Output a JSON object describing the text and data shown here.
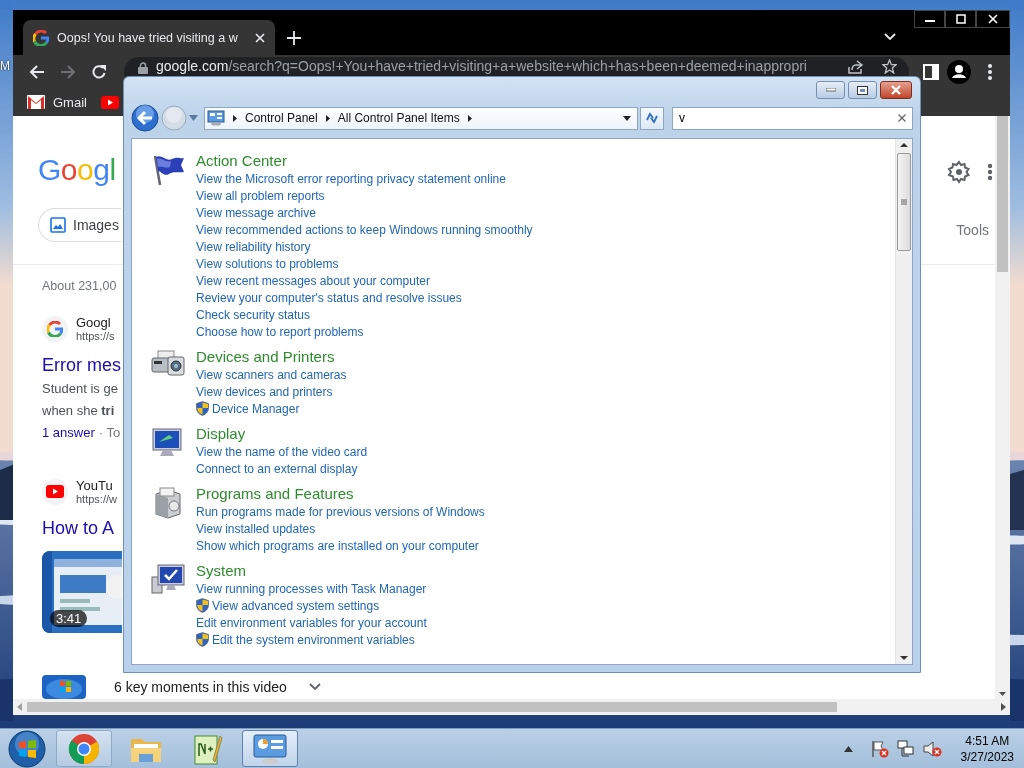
{
  "desktop": {
    "icon_label": "M"
  },
  "browser": {
    "tab": {
      "title": "Oops! You have tried visiting a w",
      "selected": true
    },
    "forward": {
      "disabled": true
    },
    "url": {
      "host": "google.com",
      "path": "/search?q=Oops!+You+have+tried+visiting+a+website+which+has+been+deemed+inappropri"
    },
    "bookmarks": [
      {
        "kind": "gmail",
        "label": "Gmail"
      },
      {
        "kind": "youtube"
      }
    ],
    "page": {
      "logo": "Googl",
      "chip": "Images",
      "tools": "Tools",
      "stats": "About 231,00",
      "results": [
        {
          "kind": "google",
          "site": "Googl",
          "url": "https://s",
          "title": "Error mes",
          "snippet": [
            "Student is ge",
            "when she **tri**"
          ],
          "answers": "1 answer",
          "date": "· To"
        },
        {
          "kind": "youtube",
          "site": "YouTu",
          "url": "https://w",
          "title": "How to A",
          "duration": "3:41"
        }
      ],
      "key_moments": "6 key moments in this video"
    }
  },
  "control_panel": {
    "forward": {
      "disabled": true
    },
    "breadcrumbs": [
      "Control Panel",
      "All Control Panel Items"
    ],
    "search": {
      "value": "v"
    },
    "groups": [
      {
        "kind": "flag",
        "title": "Action Center",
        "links": [
          {
            "text": "View the Microsoft error reporting privacy statement online",
            "shield": false
          },
          {
            "text": "View all problem reports",
            "shield": false
          },
          {
            "text": "View message archive",
            "shield": false
          },
          {
            "text": "View recommended actions to keep Windows running smoothly",
            "shield": false
          },
          {
            "text": "View reliability history",
            "shield": false
          },
          {
            "text": "View solutions to problems",
            "shield": false
          },
          {
            "text": "View recent messages about your computer",
            "shield": false
          },
          {
            "text": "Review your computer's status and resolve issues",
            "shield": false
          },
          {
            "text": "Check security status",
            "shield": false
          },
          {
            "text": "Choose how to report problems",
            "shield": false
          }
        ]
      },
      {
        "kind": "devices",
        "title": "Devices and Printers",
        "links": [
          {
            "text": "View scanners and cameras",
            "shield": false
          },
          {
            "text": "View devices and printers",
            "shield": false
          },
          {
            "text": "Device Manager",
            "shield": true
          }
        ]
      },
      {
        "kind": "display",
        "title": "Display",
        "links": [
          {
            "text": "View the name of the video card",
            "shield": false
          },
          {
            "text": "Connect to an external display",
            "shield": false
          }
        ]
      },
      {
        "kind": "programs",
        "title": "Programs and Features",
        "links": [
          {
            "text": "Run programs made for previous versions of Windows",
            "shield": false
          },
          {
            "text": "View installed updates",
            "shield": false
          },
          {
            "text": "Show which programs are installed on your computer",
            "shield": false
          }
        ]
      },
      {
        "kind": "system",
        "title": "System",
        "links": [
          {
            "text": "View running processes with Task Manager",
            "shield": false
          },
          {
            "text": "View advanced system settings",
            "shield": true
          },
          {
            "text": "Edit environment variables for your account",
            "shield": false
          },
          {
            "text": "Edit the system environment variables",
            "shield": true
          }
        ]
      }
    ]
  },
  "taskbar": {
    "apps": [
      {
        "kind": "chrome",
        "running": true,
        "selected": false
      },
      {
        "kind": "explorer",
        "running": false,
        "selected": false
      },
      {
        "kind": "notepad",
        "running": false,
        "selected": false
      },
      {
        "kind": "control-panel",
        "running": true,
        "selected": true
      }
    ],
    "time": "4:51 AM",
    "date": "3/27/2023"
  }
}
